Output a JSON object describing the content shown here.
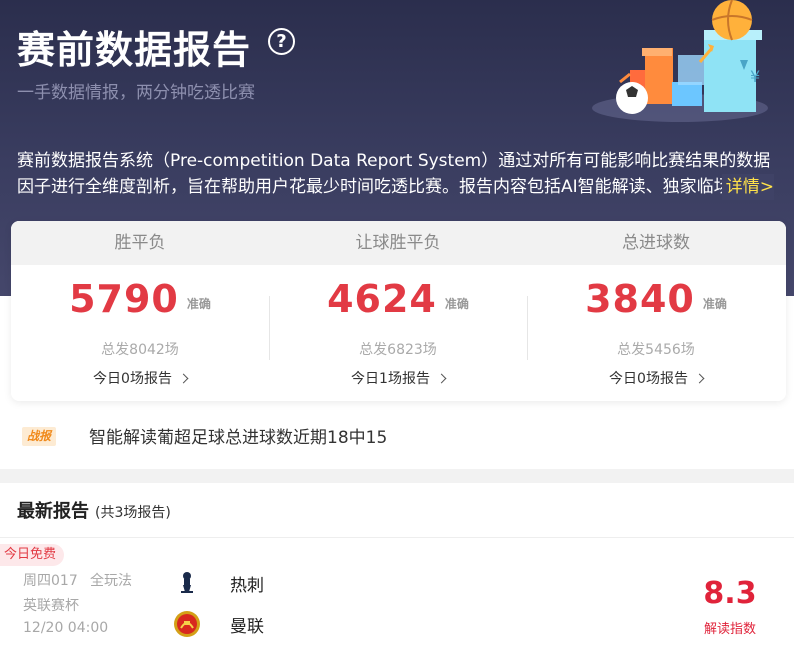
{
  "header": {
    "title": "赛前数据报告",
    "subtitle": "一手数据情报，两分钟吃透比赛",
    "help_symbol": "?",
    "description": "赛前数据报告系统（Pre-competition Data Report System）通过对所有可能影响比赛结果的数据因子进行全维度剖析，旨在帮助用户花最少时间吃透比赛。报告内容包括AI智能解读、独家临场情报",
    "more_label": "详情>"
  },
  "stats": [
    {
      "label": "胜平负",
      "value": "5790",
      "tag": "准确",
      "total": "总发8042场",
      "today": "今日0场报告"
    },
    {
      "label": "让球胜平负",
      "value": "4624",
      "tag": "准确",
      "total": "总发6823场",
      "today": "今日1场报告"
    },
    {
      "label": "总进球数",
      "value": "3840",
      "tag": "准确",
      "total": "总发5456场",
      "today": "今日0场报告"
    }
  ],
  "ticker": {
    "badge": "战报",
    "text": "智能解读葡超足球总进球数近期18中15"
  },
  "latest": {
    "title": "最新报告",
    "count": "(共3场报告)"
  },
  "match": {
    "badge": "今日免费",
    "code": "周四017",
    "play": "全玩法",
    "league": "英联赛杯",
    "time": "12/20 04:00",
    "home": "热刺",
    "away": "曼联",
    "index": "8.3",
    "index_label": "解读指数"
  },
  "colors": {
    "accent_red": "#e23a44",
    "header_bg": "#2b2e4d",
    "more_link": "#ffe24a",
    "badge_orange": "#f08a1c"
  }
}
